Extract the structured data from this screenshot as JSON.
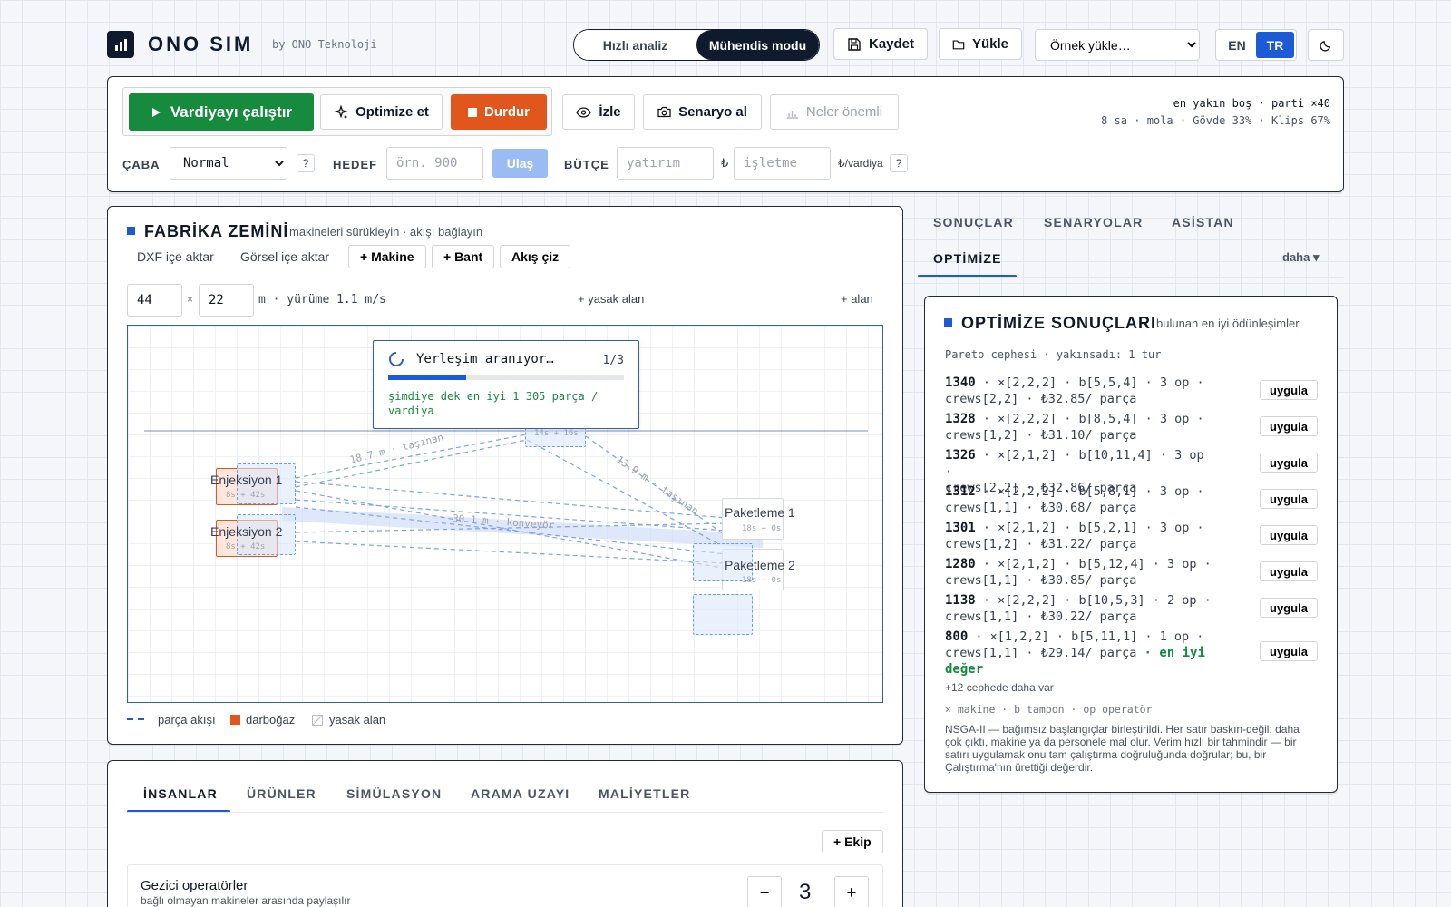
{
  "header": {
    "brand": "ONO SIM",
    "by": "by ONO Teknoloji",
    "mode_quick": "Hızlı analiz",
    "mode_engineer": "Mühendis modu",
    "save": "Kaydet",
    "load": "Yükle",
    "example_select": "Örnek yükle…",
    "lang_en": "EN",
    "lang_tr": "TR"
  },
  "toolbar": {
    "run": "Vardiyayı çalıştır",
    "optimize": "Optimize et",
    "stop": "Durdur",
    "watch": "İzle",
    "snapshot": "Senaryo al",
    "what_matters": "Neler önemli",
    "info_line1": "en yakın boş · parti ×40",
    "info_line2": "8 sa · mola · Gövde 33% · Klips 67%",
    "effort_label": "ÇABA",
    "effort_value": "Normal",
    "target_label": "HEDEF",
    "target_placeholder": "örn. 900",
    "reach": "Ulaş",
    "budget_label": "BÜTÇE",
    "invest_placeholder": "yatırım",
    "currency": "₺",
    "operate_placeholder": "işletme",
    "per_shift": "₺/vardiya",
    "help": "?"
  },
  "floor": {
    "title": "FABRİKA ZEMİNİ",
    "subtitle": "makineleri sürükleyin · akışı bağlayın",
    "dxf": "DXF içe aktar",
    "image": "Görsel içe aktar",
    "add_machine": "+ Makine",
    "add_belt": "+ Bant",
    "draw_flow": "Akış çiz",
    "width": "44",
    "times": "×",
    "depth": "22",
    "walk": "m · yürüme 1.1 m/s",
    "forbidden": "+ yasak alan",
    "area": "+ alan",
    "search_title": "Yerleşim aranıyor…",
    "search_step": "1/3",
    "search_progress": 0.33,
    "search_best": "şimdiye dek en iyi 1 305 parça / vardiya",
    "m1_name": "Enjeksiyon 1",
    "m1_times": "8s + 42s",
    "m2_name": "Enjeksiyon 2",
    "m2_times": "8s + 42s",
    "m3_name": "Paketleme 1",
    "m3_times": "18s + 0s",
    "m4_name": "Paketleme 2",
    "m4_times": "18s + 0s",
    "top_times": "14s + 16s",
    "edge1": "18.7 m · taşınan",
    "edge2": "13.9 m · taşınan",
    "edge3": "30.1 m · konveyör",
    "legend_flow": "parça akışı",
    "legend_bottleneck": "darboğaz",
    "legend_forbidden": "yasak alan"
  },
  "bottom": {
    "tabs": [
      "İNSANLAR",
      "ÜRÜNLER",
      "SİMÜLASYON",
      "ARAMA UZAYI",
      "MALİYETLER"
    ],
    "add_crew": "+ Ekip",
    "rover_title": "Gezici operatörler",
    "rover_sub": "bağlı olmayan makineler arasında paylaşılır",
    "minus": "−",
    "count": "3",
    "plus": "+"
  },
  "right": {
    "tabs": [
      "SONUÇLAR",
      "SENARYOLAR",
      "ASİSTAN",
      "OPTİMİZE"
    ],
    "more": "daha ▾",
    "title": "OPTİMİZE SONUÇLARI",
    "subtitle": "bulunan en iyi ödünleşimler",
    "pareto": "Pareto cephesi · yakınsadı: 1 tur",
    "apply": "uygula",
    "rows": [
      {
        "score": "1340",
        "l1": " · ×[2,2,2] · b[5,5,4] · 3 op ·",
        "l2": "crews[2,2] · ₺32.85/ parça"
      },
      {
        "score": "1328",
        "l1": " · ×[2,2,2] · b[8,5,4] · 3 op ·",
        "l2": "crews[1,2] · ₺31.10/ parça"
      },
      {
        "score": "1326",
        "l1": " · ×[2,1,2] · b[10,11,4] · 3 op ·",
        "l2": "crews[2,2] · ₺32.86/ parça"
      },
      {
        "score": "1312",
        "l1": " · ×[2,2,2] · b[5,8,1] · 3 op ·",
        "l2": "crews[1,1] · ₺30.68/ parça"
      },
      {
        "score": "1301",
        "l1": " · ×[2,1,2] · b[5,2,1] · 3 op ·",
        "l2": "crews[1,2] · ₺31.22/ parça"
      },
      {
        "score": "1280",
        "l1": " · ×[2,1,2] · b[5,12,4] · 3 op ·",
        "l2": "crews[1,1] · ₺30.85/ parça"
      },
      {
        "score": "1138",
        "l1": " · ×[2,2,2] · b[10,5,3] · 2 op ·",
        "l2": "crews[1,1] · ₺30.22/ parça"
      },
      {
        "score": "800",
        "l1": " · ×[1,2,2] · b[5,11,1] · 1 op ·",
        "l2": "crews[1,1] · ₺29.14/ parça",
        "best": "· en iyi",
        "best2": "değer"
      }
    ],
    "more_front": "+12 cephede daha var",
    "legend": "× makine · b tampon · op operatör",
    "note": "NSGA-II — bağımsız başlangıçlar birleştirildi. Her satır baskın-değil: daha çok çıktı, makine ya da personele mal olur. Verim hızlı bir tahmindir — bir satırı uygulamak onu tam çalıştırma doğruluğunda doğrular; bu, bir Çalıştırma'nın ürettiği değerdir."
  },
  "colors": {
    "accent": "#1d5bd6",
    "run": "#168a3d",
    "stop": "#e1561c",
    "navy": "#0f1b2d"
  }
}
